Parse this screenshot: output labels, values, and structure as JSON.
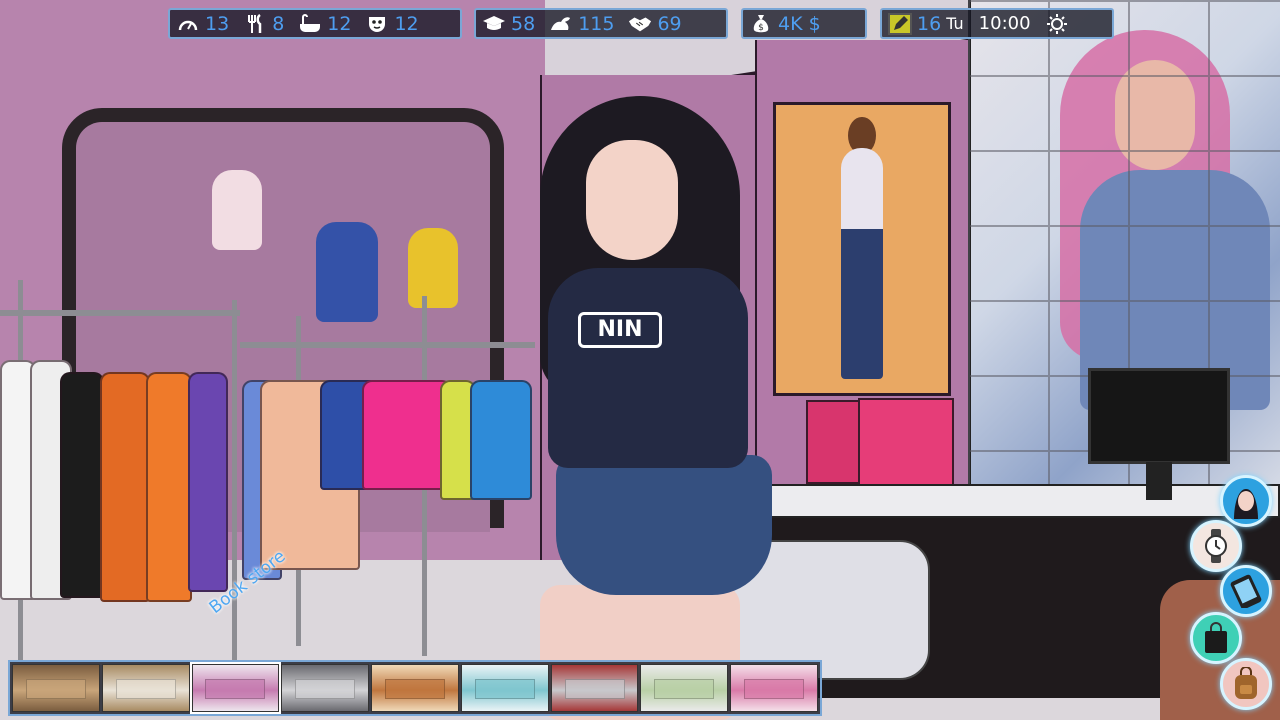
{
  "hud": {
    "energy": "13",
    "food": "8",
    "hygiene": "12",
    "mood": "12",
    "education": "58",
    "strength": "115",
    "charisma": "69",
    "money": "4K $",
    "day": "16",
    "weekday": "Tu",
    "time": "10:00"
  },
  "location": {
    "label": "Book store"
  },
  "locations_strip": {
    "count": 9,
    "active_index": 2,
    "thumbs": [
      {
        "name": "mall-hall",
        "c1": "#c9a57a",
        "c2": "#7b5d3f"
      },
      {
        "name": "bakery",
        "c1": "#e9e2d6",
        "c2": "#a88b63"
      },
      {
        "name": "book-store",
        "c1": "#c67bb0",
        "c2": "#eee6ee"
      },
      {
        "name": "furniture",
        "c1": "#d3d3d6",
        "c2": "#6a6a70"
      },
      {
        "name": "bar",
        "c1": "#c0763e",
        "c2": "#f0d9b8"
      },
      {
        "name": "electronics",
        "c1": "#7fc6cf",
        "c2": "#eaf3f6"
      },
      {
        "name": "office",
        "c1": "#c8c8cc",
        "c2": "#a63838"
      },
      {
        "name": "garden-shop",
        "c1": "#b9d0a6",
        "c2": "#eaeaea"
      },
      {
        "name": "jewelry",
        "c1": "#d97aa8",
        "c2": "#f4dfe9"
      }
    ]
  },
  "colors": {
    "hud_text": "#4e9ef0",
    "hud_border": "#7aa7d6",
    "side_ring": "#d7f4ff"
  },
  "side_buttons": [
    {
      "name": "character-portrait-button",
      "icon": "portrait-icon",
      "bg": "#2da1e0"
    },
    {
      "name": "wait-button",
      "icon": "watch-icon",
      "bg": "#f3e6e0"
    },
    {
      "name": "phone-button",
      "icon": "phone-icon",
      "bg": "#2da1e0"
    },
    {
      "name": "shopping-button",
      "icon": "shopping-bag-icon",
      "bg": "#3fd0b6"
    },
    {
      "name": "inventory-button",
      "icon": "backpack-icon",
      "bg": "#f1c6c0"
    }
  ]
}
